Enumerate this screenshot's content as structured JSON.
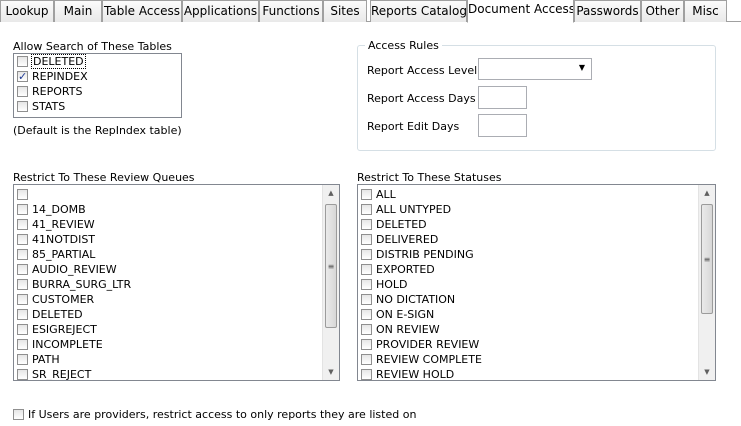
{
  "tabs": [
    {
      "label": "Lookup"
    },
    {
      "label": "Main"
    },
    {
      "label": "Table Access"
    },
    {
      "label": "Applications"
    },
    {
      "label": "Functions"
    },
    {
      "label": "Sites"
    },
    {
      "label": "Reports Catalog"
    },
    {
      "label": "Document Access"
    },
    {
      "label": "Passwords"
    },
    {
      "label": "Other"
    },
    {
      "label": "Misc"
    }
  ],
  "search_tables": {
    "label": "Allow Search of These Tables",
    "items": [
      {
        "label": "DELETED",
        "checked": false
      },
      {
        "label": "REPINDEX",
        "checked": true
      },
      {
        "label": "REPORTS",
        "checked": false
      },
      {
        "label": "STATS",
        "checked": false
      }
    ],
    "note": "(Default is the RepIndex table)"
  },
  "access_rules": {
    "title": "Access Rules",
    "level_label": "Report Access Level",
    "level_value": "",
    "days_label": "Report Access Days",
    "days_value": "",
    "edit_label": "Report Edit Days",
    "edit_value": ""
  },
  "review_queues": {
    "label": "Restrict To These Review Queues",
    "items": [
      "",
      "14_DOMB",
      "41_REVIEW",
      "41NOTDIST",
      "85_PARTIAL",
      "AUDIO_REVIEW",
      "BURRA_SURG_LTR",
      "CUSTOMER",
      "DELETED",
      "ESIGREJECT",
      "INCOMPLETE",
      "PATH",
      "SR_REJECT"
    ]
  },
  "statuses": {
    "label": "Restrict To These Statuses",
    "items": [
      "ALL",
      "ALL UNTYPED",
      "DELETED",
      "DELIVERED",
      "DISTRIB PENDING",
      "EXPORTED",
      "HOLD",
      "NO DICTATION",
      "ON E-SIGN",
      "ON REVIEW",
      "PROVIDER REVIEW",
      "REVIEW COMPLETE",
      "REVIEW HOLD"
    ]
  },
  "provider_option": {
    "label": "If Users are providers, restrict access to only reports they are listed on",
    "checked": false
  },
  "icons": {
    "dropdown": "chevron-down-icon",
    "scroll_up": "scroll-up-icon",
    "scroll_down": "scroll-down-icon",
    "grip": "scroll-grip-icon"
  }
}
